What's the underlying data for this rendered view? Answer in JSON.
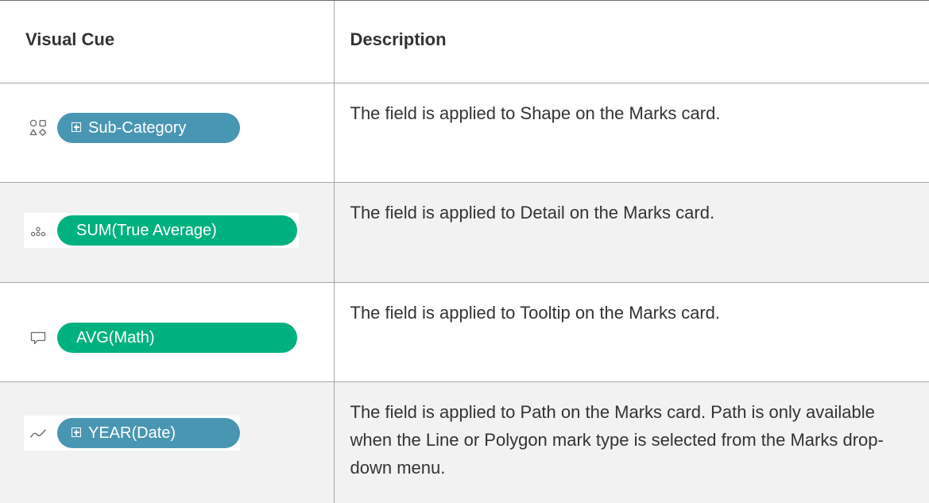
{
  "table": {
    "headers": {
      "visual_cue": "Visual Cue",
      "description": "Description"
    },
    "rows": [
      {
        "icon": "shape-icon",
        "pill_label": "Sub-Category",
        "pill_color": "#4996b2",
        "pill_has_expand": true,
        "description": "The field is applied to Shape on the Marks card."
      },
      {
        "icon": "detail-icon",
        "pill_label": "SUM(True Average)",
        "pill_color": "#00b180",
        "pill_has_expand": false,
        "description": "The field is applied to Detail on the Marks card."
      },
      {
        "icon": "tooltip-icon",
        "pill_label": "AVG(Math)",
        "pill_color": "#00b180",
        "pill_has_expand": false,
        "description": "The field is applied to Tooltip on the Marks card."
      },
      {
        "icon": "path-icon",
        "pill_label": "YEAR(Date)",
        "pill_color": "#4996b2",
        "pill_has_expand": true,
        "description": "The field is applied to Path on the Marks card. Path is only available when the Line or Polygon mark type is selected from the Marks drop-down menu."
      }
    ]
  },
  "colors": {
    "dimension_pill": "#4996b2",
    "measure_pill": "#00b180",
    "shaded_row": "#f2f2f2",
    "text": "#333333"
  }
}
